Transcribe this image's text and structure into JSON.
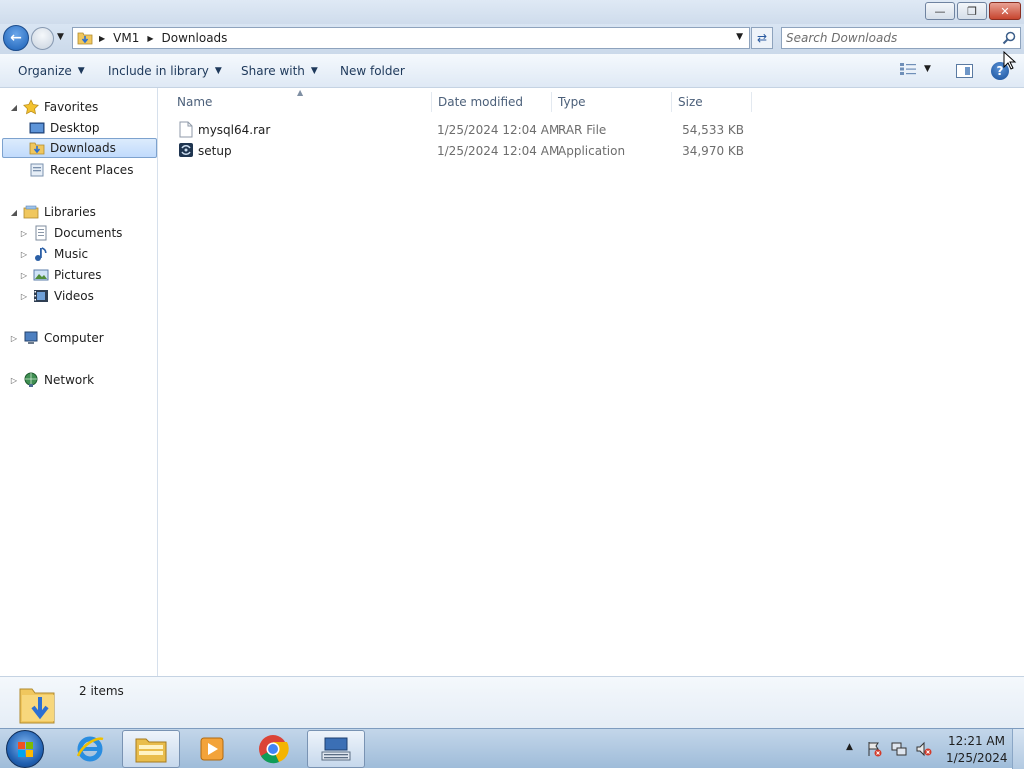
{
  "window": {
    "minimize_glyph": "—",
    "maximize_glyph": "❐",
    "close_glyph": "✕"
  },
  "address_bar": {
    "crumbs": [
      "VM1",
      "Downloads"
    ],
    "search_placeholder": "Search Downloads"
  },
  "command_bar": {
    "organize_label": "Organize",
    "include_label": "Include in library",
    "share_label": "Share with",
    "new_folder_label": "New folder",
    "help_glyph": "?"
  },
  "nav_pane": {
    "favorites_label": "Favorites",
    "favorites_items": [
      "Desktop",
      "Downloads",
      "Recent Places"
    ],
    "libraries_label": "Libraries",
    "libraries_items": [
      "Documents",
      "Music",
      "Pictures",
      "Videos"
    ],
    "computer_label": "Computer",
    "network_label": "Network"
  },
  "file_list": {
    "columns": [
      "Name",
      "Date modified",
      "Type",
      "Size"
    ],
    "rows": [
      {
        "name": "mysql64.rar",
        "date": "1/25/2024 12:04 AM",
        "type": "RAR File",
        "size": "54,533 KB",
        "icon": "file-icon"
      },
      {
        "name": "setup",
        "date": "1/25/2024 12:04 AM",
        "type": "Application",
        "size": "34,970 KB",
        "icon": "installer-icon"
      }
    ]
  },
  "details_pane": {
    "item_count": "2 items"
  },
  "taskbar": {
    "apps": [
      "internet-explorer-icon",
      "file-explorer-icon",
      "media-player-icon",
      "chrome-icon",
      "keyboard-icon"
    ],
    "clock_time": "12:21 AM",
    "clock_date": "1/25/2024"
  },
  "colors": {
    "accent": "#1a5fb5",
    "selected_bg": "#c1dbfc",
    "header_text": "#4c607a"
  }
}
